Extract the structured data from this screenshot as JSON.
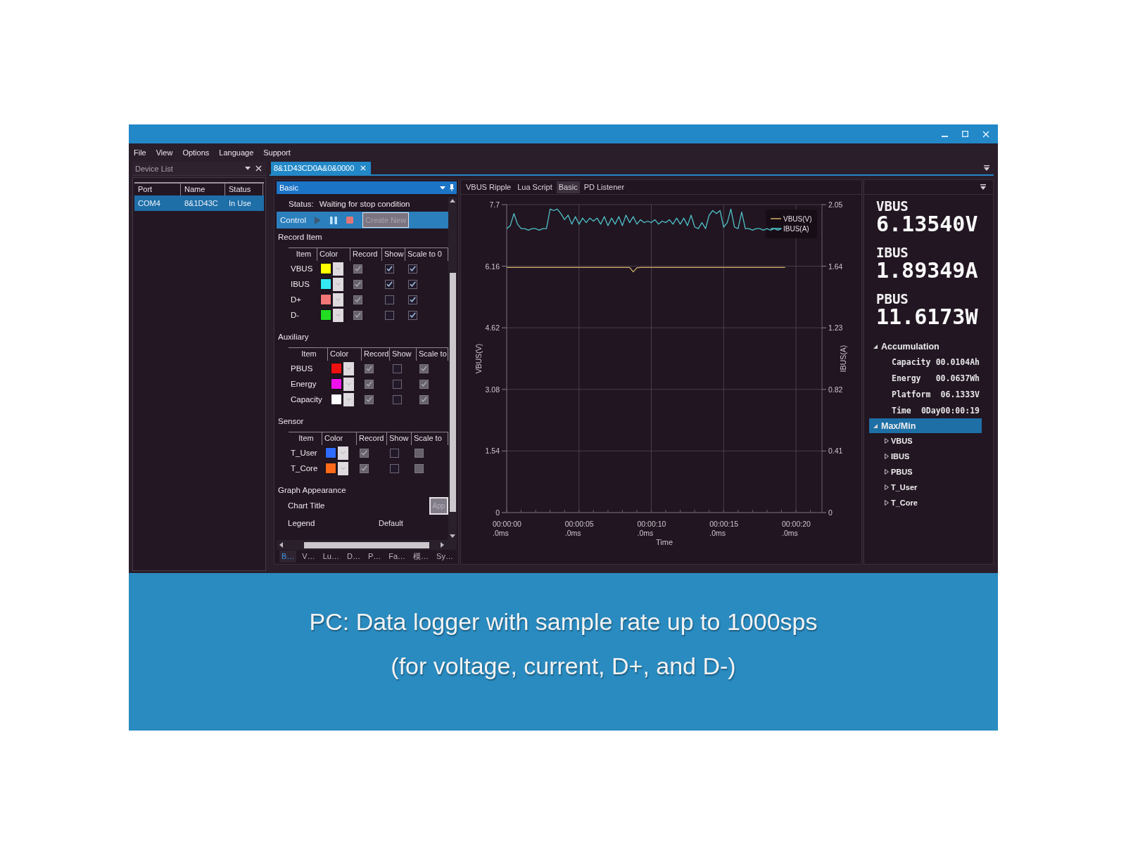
{
  "menu": [
    {
      "label": "File"
    },
    {
      "label": "View"
    },
    {
      "label": "Options"
    },
    {
      "label": "Language"
    },
    {
      "label": "Support"
    }
  ],
  "device_list": {
    "title": "Device List",
    "columns": [
      "Port",
      "Name",
      "Status"
    ],
    "rows": [
      {
        "cells": [
          "COM4",
          "8&1D43C",
          "In Use"
        ],
        "selected": true
      }
    ]
  },
  "document_tab": {
    "label": "8&1D43CD0A&0&0000",
    "selected": true
  },
  "settings": {
    "title": "Basic",
    "status_label": "Status:",
    "status": "Waiting for stop condition",
    "control": {
      "label": "Control",
      "buttons": [
        {
          "kind": "play",
          "disabled": true
        },
        {
          "kind": "pause",
          "disabled": false
        },
        {
          "kind": "stop",
          "disabled": false
        }
      ],
      "create_button": {
        "label": "Create New",
        "disabled": true
      }
    },
    "sections": [
      {
        "title": "Record Item",
        "columns": [
          "Item",
          "Color",
          "Record",
          "Show",
          "Scale to 0"
        ],
        "rows": [
          {
            "item": "VBUS",
            "color": "#ffff00",
            "record": {
              "checked": true,
              "disabled": true
            },
            "show": {
              "checked": true,
              "disabled": false
            },
            "scale_to_0": {
              "checked": true,
              "disabled": false
            }
          },
          {
            "item": "IBUS",
            "color": "#33e8f2",
            "record": {
              "checked": true,
              "disabled": true
            },
            "show": {
              "checked": true,
              "disabled": false
            },
            "scale_to_0": {
              "checked": true,
              "disabled": false
            }
          },
          {
            "item": "D+",
            "color": "#f27878",
            "record": {
              "checked": true,
              "disabled": true
            },
            "show": {
              "checked": false,
              "disabled": false
            },
            "scale_to_0": {
              "checked": true,
              "disabled": false
            }
          },
          {
            "item": "D-",
            "color": "#22dd22",
            "record": {
              "checked": true,
              "disabled": true
            },
            "show": {
              "checked": false,
              "disabled": false
            },
            "scale_to_0": {
              "checked": true,
              "disabled": false
            }
          }
        ]
      },
      {
        "title": "Auxiliary",
        "columns": [
          "Item",
          "Color",
          "Record",
          "Show",
          "Scale to"
        ],
        "rows": [
          {
            "item": "PBUS",
            "color": "#ee1111",
            "record": {
              "checked": true,
              "disabled": true
            },
            "show": {
              "checked": false,
              "disabled": false
            },
            "scale_to_0": {
              "checked": true,
              "disabled": true
            }
          },
          {
            "item": "Energy",
            "color": "#ee11ee",
            "record": {
              "checked": true,
              "disabled": true
            },
            "show": {
              "checked": false,
              "disabled": false
            },
            "scale_to_0": {
              "checked": true,
              "disabled": true
            }
          },
          {
            "item": "Capacity",
            "color": "#ffffff",
            "record": {
              "checked": true,
              "disabled": true
            },
            "show": {
              "checked": false,
              "disabled": false
            },
            "scale_to_0": {
              "checked": true,
              "disabled": true
            }
          }
        ]
      },
      {
        "title": "Sensor",
        "columns": [
          "Item",
          "Color",
          "Record",
          "Show",
          "Scale to"
        ],
        "rows": [
          {
            "item": "T_User",
            "color": "#2f6bff",
            "record": {
              "checked": true,
              "disabled": true
            },
            "show": {
              "checked": false,
              "disabled": false
            },
            "scale_to_0": {
              "checked": false,
              "disabled": true
            }
          },
          {
            "item": "T_Core",
            "color": "#ff6a1a",
            "record": {
              "checked": true,
              "disabled": true
            },
            "show": {
              "checked": false,
              "disabled": false
            },
            "scale_to_0": {
              "checked": false,
              "disabled": true
            }
          }
        ]
      }
    ],
    "graph_appearance": {
      "title": "Graph Appearance",
      "fields": [
        {
          "kind": "button",
          "label": "Chart Title",
          "button": "App"
        },
        {
          "kind": "dropdown",
          "label": "Legend",
          "value": "Default"
        }
      ]
    },
    "bottom_tabs": [
      {
        "label": "B…",
        "selected": true
      },
      {
        "label": "V…",
        "selected": false
      },
      {
        "label": "Lu…",
        "selected": false
      },
      {
        "label": "D…",
        "selected": false
      },
      {
        "label": "P…",
        "selected": false
      },
      {
        "label": "Fa…",
        "selected": false
      },
      {
        "label": "模…",
        "selected": false
      },
      {
        "label": "Sy…",
        "selected": false
      }
    ]
  },
  "chart_tabs": [
    {
      "label": "VBUS Ripple",
      "selected": false
    },
    {
      "label": "Lua Script",
      "selected": false
    },
    {
      "label": "Basic",
      "selected": true
    },
    {
      "label": "PD Listener",
      "selected": false
    }
  ],
  "chart": {
    "chart_data": {
      "type": "line",
      "xlabel": "Time",
      "ylabel": "VBUS(V)",
      "y2label": "IBUS(A)",
      "grid": true,
      "legend": "upper right",
      "categories": [
        "00:00:00\n.0ms",
        null,
        null,
        null,
        null,
        null,
        null,
        null,
        null,
        null,
        null,
        null,
        null,
        null,
        null,
        null,
        null,
        null,
        null,
        null,
        "00:00:05\n.0ms",
        null,
        null,
        null,
        null,
        null,
        null,
        null,
        null,
        null,
        null,
        null,
        null,
        null,
        null,
        null,
        null,
        null,
        null,
        null,
        "00:00:10\n.0ms",
        null,
        null,
        null,
        null,
        null,
        null,
        null,
        null,
        null,
        null,
        null,
        null,
        null,
        null,
        null,
        null,
        null,
        null,
        null,
        "00:00:15\n.0ms",
        null,
        null,
        null,
        null,
        null,
        null,
        null,
        null,
        null,
        null,
        null,
        null,
        null,
        null,
        null,
        null,
        null,
        null,
        null,
        "00:00:20\n.0ms",
        null,
        null,
        null,
        null,
        null,
        null,
        null
      ],
      "series": [
        {
          "name": "VBUS(V)",
          "color": "#d2b06a",
          "values": [
            6.13,
            6.13,
            6.13,
            6.13,
            6.13,
            6.13,
            6.13,
            6.13,
            6.13,
            6.13,
            6.13,
            6.13,
            6.13,
            6.13,
            6.13,
            6.13,
            6.13,
            6.13,
            6.13,
            6.13,
            6.13,
            6.13,
            6.13,
            6.13,
            6.13,
            6.13,
            6.13,
            6.13,
            6.13,
            6.13,
            6.13,
            6.13,
            6.13,
            6.13,
            6.13,
            6.02,
            6.12,
            6.13,
            6.13,
            6.13,
            6.13,
            6.13,
            6.13,
            6.13,
            6.13,
            6.13,
            6.13,
            6.13,
            6.13,
            6.13,
            6.13,
            6.13,
            6.13,
            6.13,
            6.13,
            6.13,
            6.13,
            6.13,
            6.13,
            6.13,
            6.13,
            6.13,
            6.13,
            6.13,
            6.13,
            6.13,
            6.13,
            6.13,
            6.13,
            6.13,
            6.13,
            6.13,
            6.13,
            6.13,
            6.13,
            6.13,
            6.13,
            6.13,
            null,
            null,
            null,
            null,
            null,
            null,
            null,
            null,
            null,
            null
          ]
        },
        {
          "name": "IBUS(A)",
          "color": "#4fc2c8",
          "axis": "y2",
          "values": [
            1.89,
            1.91,
            1.99,
            1.92,
            1.89,
            1.89,
            1.88,
            1.89,
            1.89,
            1.88,
            1.89,
            1.89,
            2.02,
            2.01,
            2.02,
            1.99,
            1.95,
            1.98,
            1.92,
            1.97,
            1.92,
            1.96,
            1.93,
            1.96,
            1.94,
            1.96,
            1.92,
            1.97,
            1.91,
            1.96,
            1.92,
            1.97,
            1.91,
            1.98,
            1.93,
            1.97,
            1.92,
            1.95,
            1.93,
            1.94,
            1.93,
            1.95,
            1.92,
            1.94,
            1.93,
            1.95,
            1.92,
            1.96,
            1.92,
            1.96,
            1.91,
            1.98,
            1.9,
            1.89,
            1.93,
            1.89,
            1.98,
            2.01,
            1.99,
            2.01,
            1.9,
            1.93,
            2.02,
            1.9,
            1.89,
            2.0,
            1.89,
            1.89,
            1.88,
            1.89,
            1.89,
            1.88,
            1.89,
            1.88,
            1.89,
            1.88,
            1.89,
            null,
            null,
            null,
            null,
            null,
            null,
            null,
            null,
            null,
            null,
            null
          ]
        }
      ],
      "ylim": [
        0,
        7.7
      ],
      "y2lim": [
        0,
        2.05
      ],
      "yticks": [
        0,
        1.54,
        3.08,
        4.62,
        6.16,
        7.7
      ],
      "y2ticks": [
        0,
        0.41,
        0.82,
        1.23,
        1.64,
        2.05
      ]
    }
  },
  "readings": [
    {
      "label": "VBUS",
      "value": "6.13540V"
    },
    {
      "label": "IBUS",
      "value": "1.89349A"
    },
    {
      "label": "PBUS",
      "value": "11.6173W"
    }
  ],
  "tree": [
    {
      "label": "Accumulation",
      "expanded": true,
      "selected": false,
      "children": [
        {
          "kind": "reading",
          "label": "Capacity",
          "value": "00.0104Ah"
        },
        {
          "kind": "reading",
          "label": "Energy",
          "value": "00.0637Wh"
        },
        {
          "kind": "reading",
          "label": "Platform",
          "value": "06.1333V"
        },
        {
          "kind": "reading",
          "label": "Time",
          "value": "0Day00:00:19"
        }
      ]
    },
    {
      "label": "Max/Min",
      "expanded": true,
      "selected": true,
      "children": [
        {
          "kind": "node",
          "label": "VBUS",
          "expanded": false,
          "selected": false
        },
        {
          "kind": "node",
          "label": "IBUS",
          "expanded": false,
          "selected": false
        },
        {
          "kind": "node",
          "label": "PBUS",
          "expanded": false,
          "selected": false
        },
        {
          "kind": "node",
          "label": "T_User",
          "expanded": false,
          "selected": false
        },
        {
          "kind": "node",
          "label": "T_Core",
          "expanded": false,
          "selected": false
        }
      ]
    }
  ],
  "banner": {
    "lines": [
      "PC: Data logger with sample rate up to 1000sps",
      "(for voltage, current, D+, and D-)"
    ]
  }
}
